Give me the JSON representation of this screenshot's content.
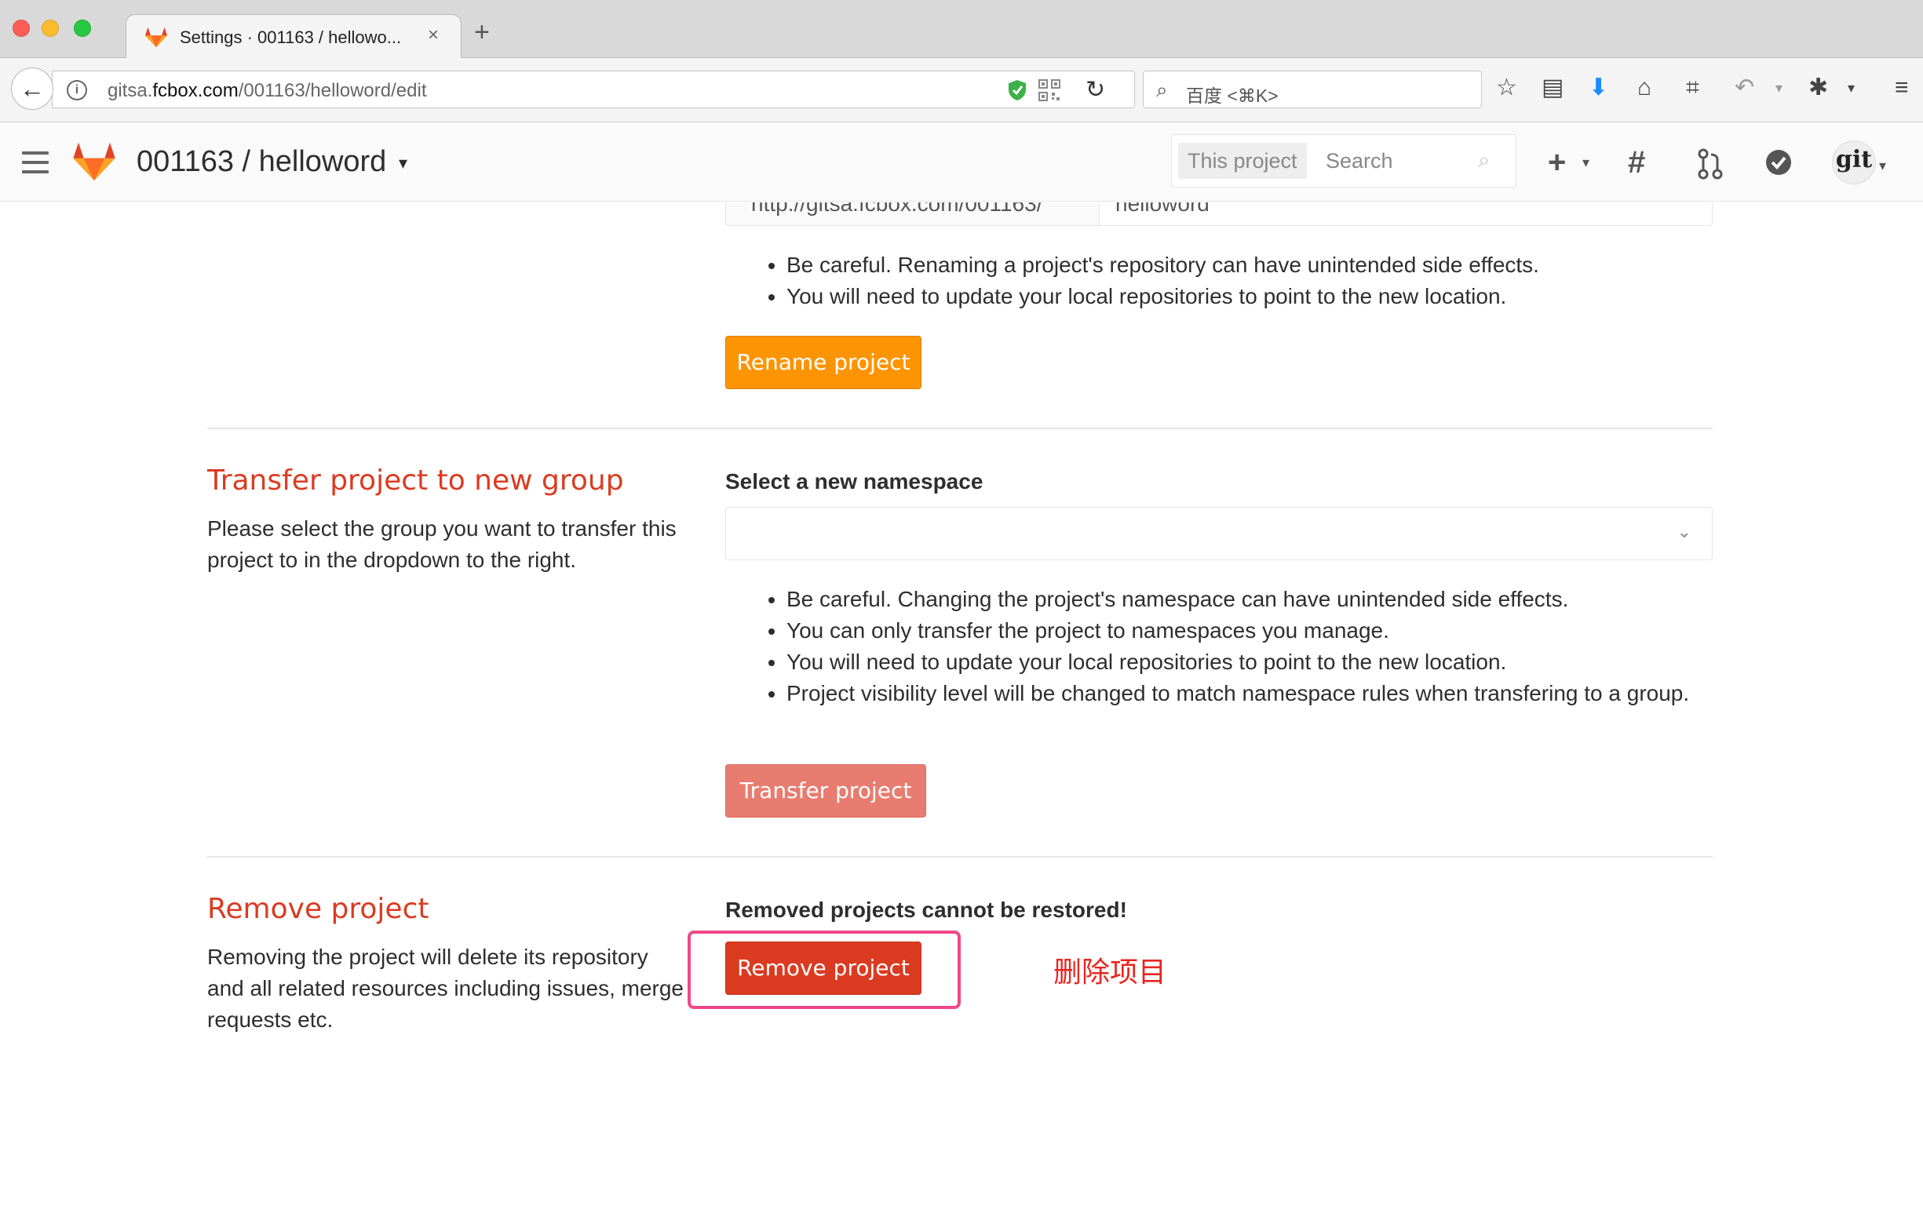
{
  "browser": {
    "tab_title": "Settings · 001163 / hellowo...",
    "tab_close": "×",
    "new_tab": "+",
    "url_prefix": "gitsa.",
    "url_domain": "fcbox.com",
    "url_path": "/001163/helloword/edit",
    "search_placeholder": "百度 <⌘K>"
  },
  "header": {
    "project_path": "001163 / helloword",
    "search_scope": "This project",
    "search_placeholder": "Search",
    "avatar_text": "git"
  },
  "rename": {
    "path_prefix": "http://gitsa.fcbox.com/001163/",
    "path_value": "helloword",
    "notes": [
      "Be careful. Renaming a project's repository can have unintended side effects.",
      "You will need to update your local repositories to point to the new location."
    ],
    "button": "Rename project"
  },
  "transfer": {
    "title": "Transfer project to new group",
    "description": "Please select the group you want to transfer this project to in the dropdown to the right.",
    "field_label": "Select a new namespace",
    "notes": [
      "Be careful. Changing the project's namespace can have unintended side effects.",
      "You can only transfer the project to namespaces you manage.",
      "You will need to update your local repositories to point to the new location.",
      "Project visibility level will be changed to match namespace rules when transfering to a group."
    ],
    "button": "Transfer project"
  },
  "remove": {
    "title": "Remove project",
    "description": "Removing the project will delete its repository and all related resources including issues, merge requests etc.",
    "warning": "Removed projects cannot be restored!",
    "button": "Remove project",
    "annotation": "删除项目"
  },
  "colors": {
    "danger": "#db3b21",
    "warning": "#fc9403",
    "transfer_button": "#e87c70",
    "highlight_border": "#f0478a"
  }
}
